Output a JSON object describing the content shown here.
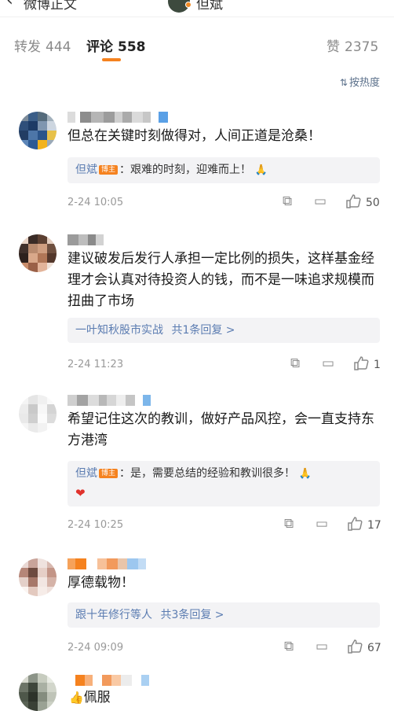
{
  "nav": {
    "back_icon": "chevron-left-icon",
    "back_label": "微博正文",
    "author_name": "但斌"
  },
  "tabs": [
    {
      "label": "转发",
      "count": "444"
    },
    {
      "label": "评论",
      "count": "558"
    },
    {
      "label": "赞",
      "count": "2375"
    }
  ],
  "sort_label": "按热度",
  "colors": {
    "accent": "#f5821f",
    "link": "#5b7cb1",
    "reply_bg": "#f3f3f5",
    "heart": "#e0322c"
  },
  "comments": [
    {
      "text": "但总在关键时刻做得对，人间正道是沧桑！",
      "reply": {
        "name": "但斌",
        "badge": "博主",
        "text": "：艰难的时刻，迎难而上！"
      },
      "time": "2-24 10:05",
      "likes": "50"
    },
    {
      "text": "建议破发后发行人承担一定比例的损失，这样基金经理才会认真对待投资人的钱，而不是一味追求规模而扭曲了市场",
      "reply": {
        "name": "一叶知秋股市实战",
        "more": "共1条回复 >"
      },
      "time": "2-24 11:23",
      "likes": "1"
    },
    {
      "text": "希望记住这次的教训，做好产品风控，会一直支持东方港湾",
      "reply": {
        "name": "但斌",
        "badge": "博主",
        "text": "：是，需要总结的经验和教训很多！"
      },
      "time": "2-24 10:25",
      "likes": "17"
    },
    {
      "text": "厚德载物！",
      "reply": {
        "name": "跟十年修行等人",
        "more": "共3条回复 >"
      },
      "time": "2-24 09:09",
      "likes": "67"
    },
    {
      "text": "佩服"
    }
  ]
}
